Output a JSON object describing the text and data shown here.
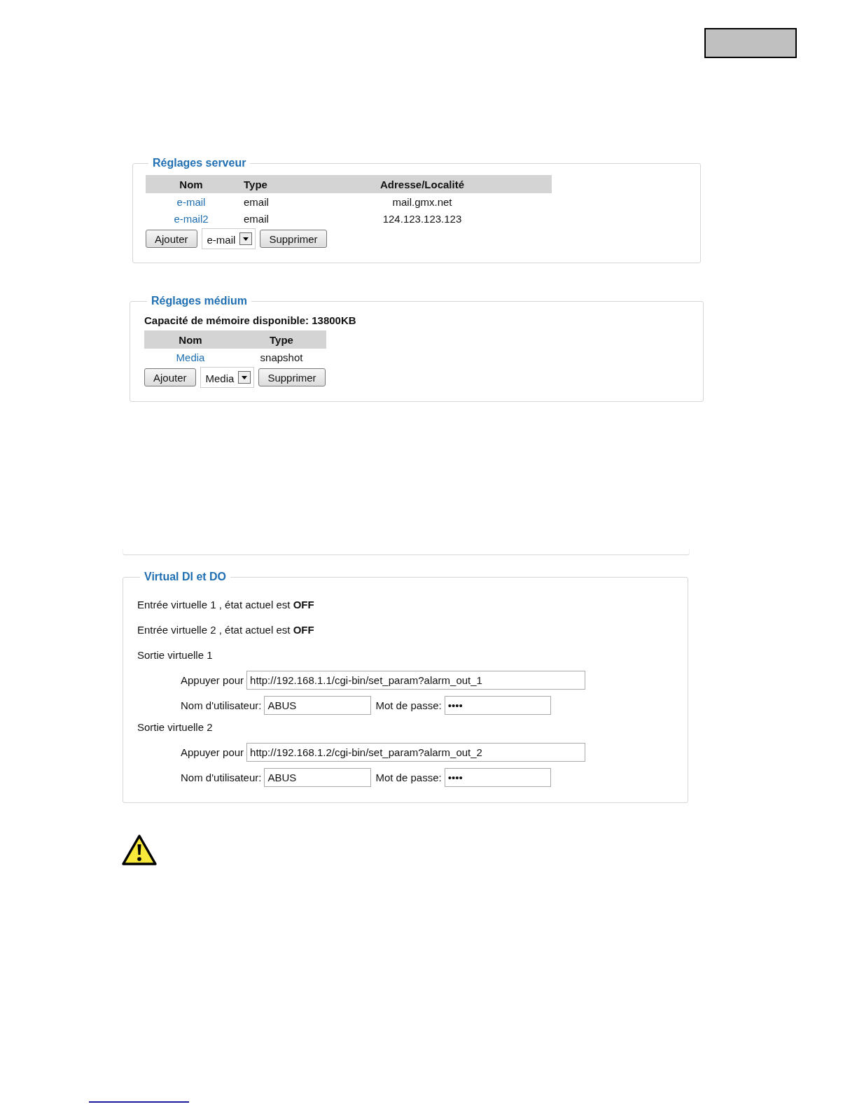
{
  "server_settings": {
    "title": "Réglages serveur",
    "columns": [
      "Nom",
      "Type",
      "Adresse/Localité"
    ],
    "rows": [
      {
        "name": "e-mail",
        "type": "email",
        "address": "mail.gmx.net"
      },
      {
        "name": "e-mail2",
        "type": "email",
        "address": "124.123.123.123"
      }
    ],
    "add_button": "Ajouter",
    "type_select": "e-mail",
    "delete_button": "Supprimer"
  },
  "media_settings": {
    "title": "Réglages médium",
    "capacity": "Capacité de mémoire disponible: 13800KB",
    "columns": [
      "Nom",
      "Type"
    ],
    "rows": [
      {
        "name": "Media",
        "type": "snapshot"
      }
    ],
    "add_button": "Ajouter",
    "type_select": "Media",
    "delete_button": "Supprimer"
  },
  "virtual_io": {
    "title": "Virtual DI et DO",
    "inputs": [
      "Entrée virtuelle 1 , état actuel est **OFF**",
      "Entrée virtuelle 2 , état actuel est **OFF**"
    ],
    "outputs": [
      {
        "title": "Sortie virtuelle 1",
        "url_label": "Appuyer pour",
        "url": "http://192.168.1.1/cgi-bin/set_param?alarm_out_1",
        "user_label": "Nom d'utilisateur:",
        "user": "ABUS",
        "password_label": "Mot de passe:",
        "password": "••••"
      },
      {
        "title": "Sortie virtuelle 2",
        "url_label": "Appuyer pour",
        "url": "http://192.168.1.2/cgi-bin/set_param?alarm_out_2",
        "user_label": "Nom d'utilisateur:",
        "user": "ABUS",
        "password_label": "Mot de passe:",
        "password": "••••"
      }
    ]
  }
}
